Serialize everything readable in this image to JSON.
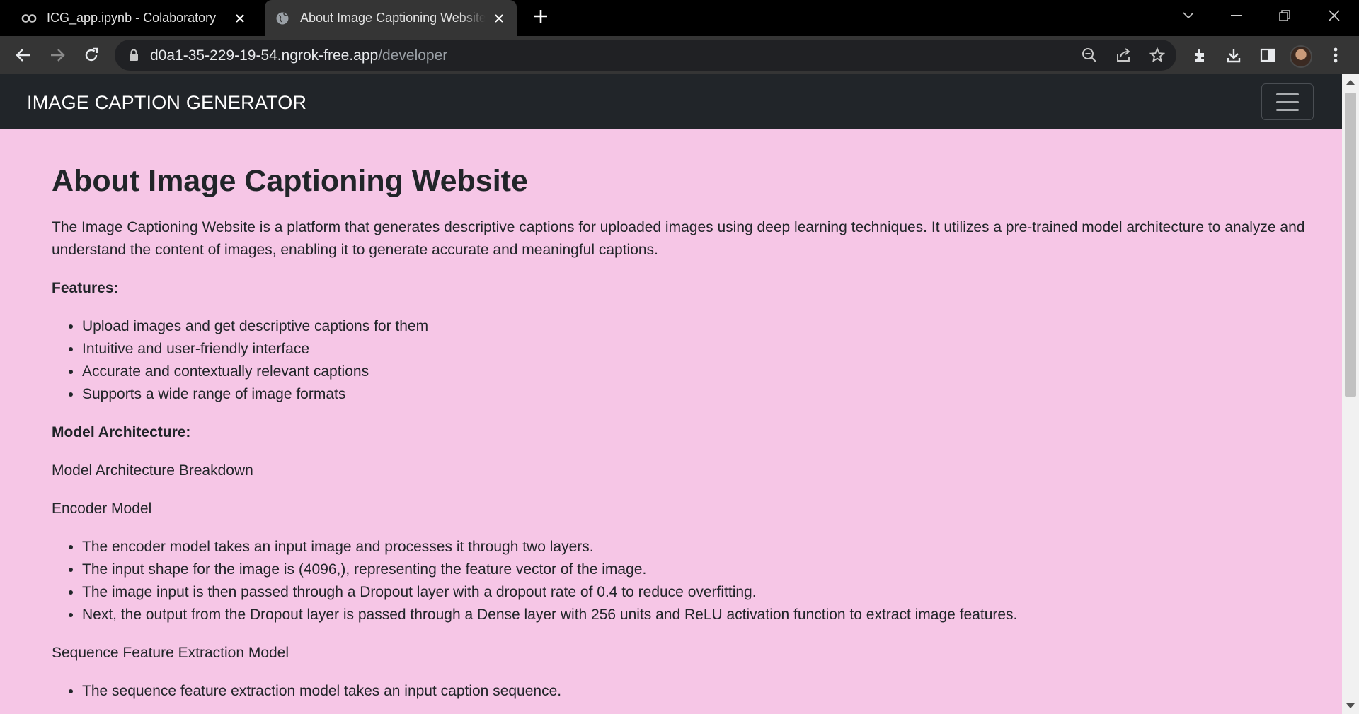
{
  "browser": {
    "tabs": [
      {
        "title": "ICG_app.ipynb - Colaboratory",
        "icon": "colab-icon",
        "active": false
      },
      {
        "title": "About Image Captioning Website",
        "icon": "globe-icon",
        "active": true
      }
    ],
    "address": {
      "host": "d0a1-35-229-19-54.ngrok-free.app",
      "path": "/developer"
    }
  },
  "navbar": {
    "brand": "IMAGE CAPTION GENERATOR"
  },
  "page": {
    "title": "About Image Captioning Website",
    "intro": "The Image Captioning Website is a platform that generates descriptive captions for uploaded images using deep learning techniques. It utilizes a pre-trained model architecture to analyze and understand the content of images, enabling it to generate accurate and meaningful captions.",
    "features_heading": "Features:",
    "features": [
      "Upload images and get descriptive captions for them",
      "Intuitive and user-friendly interface",
      "Accurate and contextually relevant captions",
      "Supports a wide range of image formats"
    ],
    "architecture_heading": "Model Architecture:",
    "breakdown": "Model Architecture Breakdown",
    "encoder_heading": "Encoder Model",
    "encoder_points": [
      "The encoder model takes an input image and processes it through two layers.",
      "The input shape for the image is (4096,), representing the feature vector of the image.",
      "The image input is then passed through a Dropout layer with a dropout rate of 0.4 to reduce overfitting.",
      "Next, the output from the Dropout layer is passed through a Dense layer with 256 units and ReLU activation function to extract image features."
    ],
    "sequence_heading": "Sequence Feature Extraction Model",
    "sequence_points": [
      "The sequence feature extraction model takes an input caption sequence."
    ]
  },
  "colors": {
    "page_bg": "#f6c6e6",
    "navbar_bg": "#212529",
    "text": "#212529"
  }
}
